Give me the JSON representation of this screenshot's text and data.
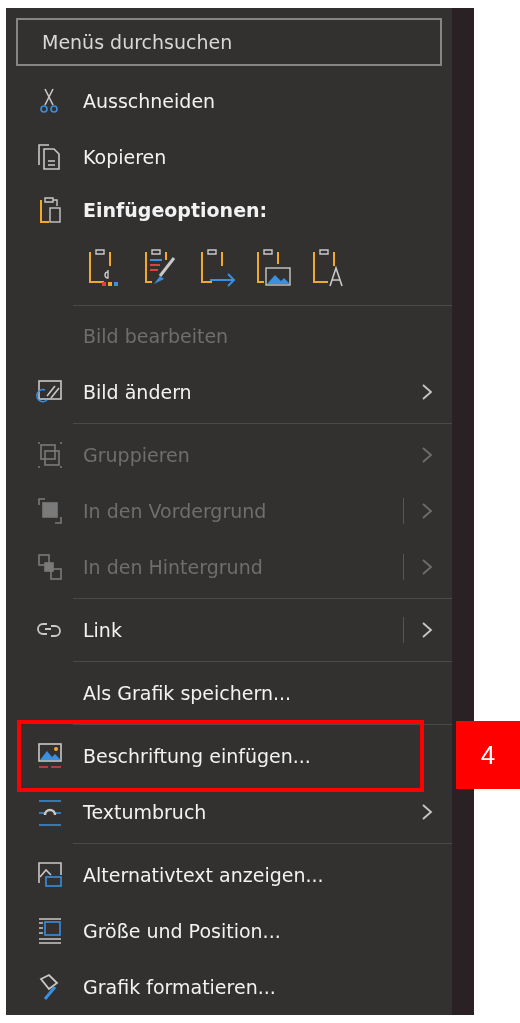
{
  "search": {
    "placeholder": "Menüs durchsuchen"
  },
  "items": [
    {
      "kind": "command",
      "label": "Ausschneiden",
      "disabled": false,
      "submenu": false,
      "split": false,
      "highlighted": false
    },
    {
      "kind": "command",
      "label": "Kopieren",
      "disabled": false,
      "submenu": false,
      "split": false,
      "highlighted": false
    },
    {
      "kind": "header",
      "label": "Einfügeoptionen:"
    },
    {
      "kind": "paste_options",
      "options": [
        {
          "disabled": false
        },
        {
          "disabled": false
        },
        {
          "disabled": false
        },
        {
          "disabled": false
        },
        {
          "disabled": false
        }
      ]
    },
    {
      "kind": "separator"
    },
    {
      "kind": "command",
      "label": "Bild bearbeiten",
      "disabled": true,
      "submenu": false,
      "split": false,
      "highlighted": false
    },
    {
      "kind": "command",
      "label": "Bild ändern",
      "disabled": false,
      "submenu": true,
      "split": false,
      "highlighted": false
    },
    {
      "kind": "separator"
    },
    {
      "kind": "command",
      "label": "Gruppieren",
      "disabled": true,
      "submenu": true,
      "split": false,
      "highlighted": false
    },
    {
      "kind": "command",
      "label": "In den Vordergrund",
      "disabled": true,
      "submenu": true,
      "split": true,
      "highlighted": false
    },
    {
      "kind": "command",
      "label": "In den Hintergrund",
      "disabled": true,
      "submenu": true,
      "split": true,
      "highlighted": false
    },
    {
      "kind": "separator"
    },
    {
      "kind": "command",
      "label": "Link",
      "disabled": false,
      "submenu": true,
      "split": true,
      "highlighted": false
    },
    {
      "kind": "separator"
    },
    {
      "kind": "command",
      "label": "Als Grafik speichern...",
      "disabled": false,
      "submenu": false,
      "split": false,
      "highlighted": false
    },
    {
      "kind": "separator"
    },
    {
      "kind": "command",
      "label": "Beschriftung einfügen...",
      "disabled": false,
      "submenu": false,
      "split": false,
      "highlighted": true
    },
    {
      "kind": "command",
      "label": "Textumbruch",
      "disabled": false,
      "submenu": true,
      "split": false,
      "highlighted": false
    },
    {
      "kind": "separator"
    },
    {
      "kind": "command",
      "label": "Alternativtext anzeigen...",
      "disabled": false,
      "submenu": false,
      "split": false,
      "highlighted": false
    },
    {
      "kind": "command",
      "label": "Größe und Position...",
      "disabled": false,
      "submenu": false,
      "split": false,
      "highlighted": false
    },
    {
      "kind": "command",
      "label": "Grafik formatieren...",
      "disabled": false,
      "submenu": false,
      "split": false,
      "highlighted": false
    }
  ],
  "annotation": {
    "label": "4"
  }
}
